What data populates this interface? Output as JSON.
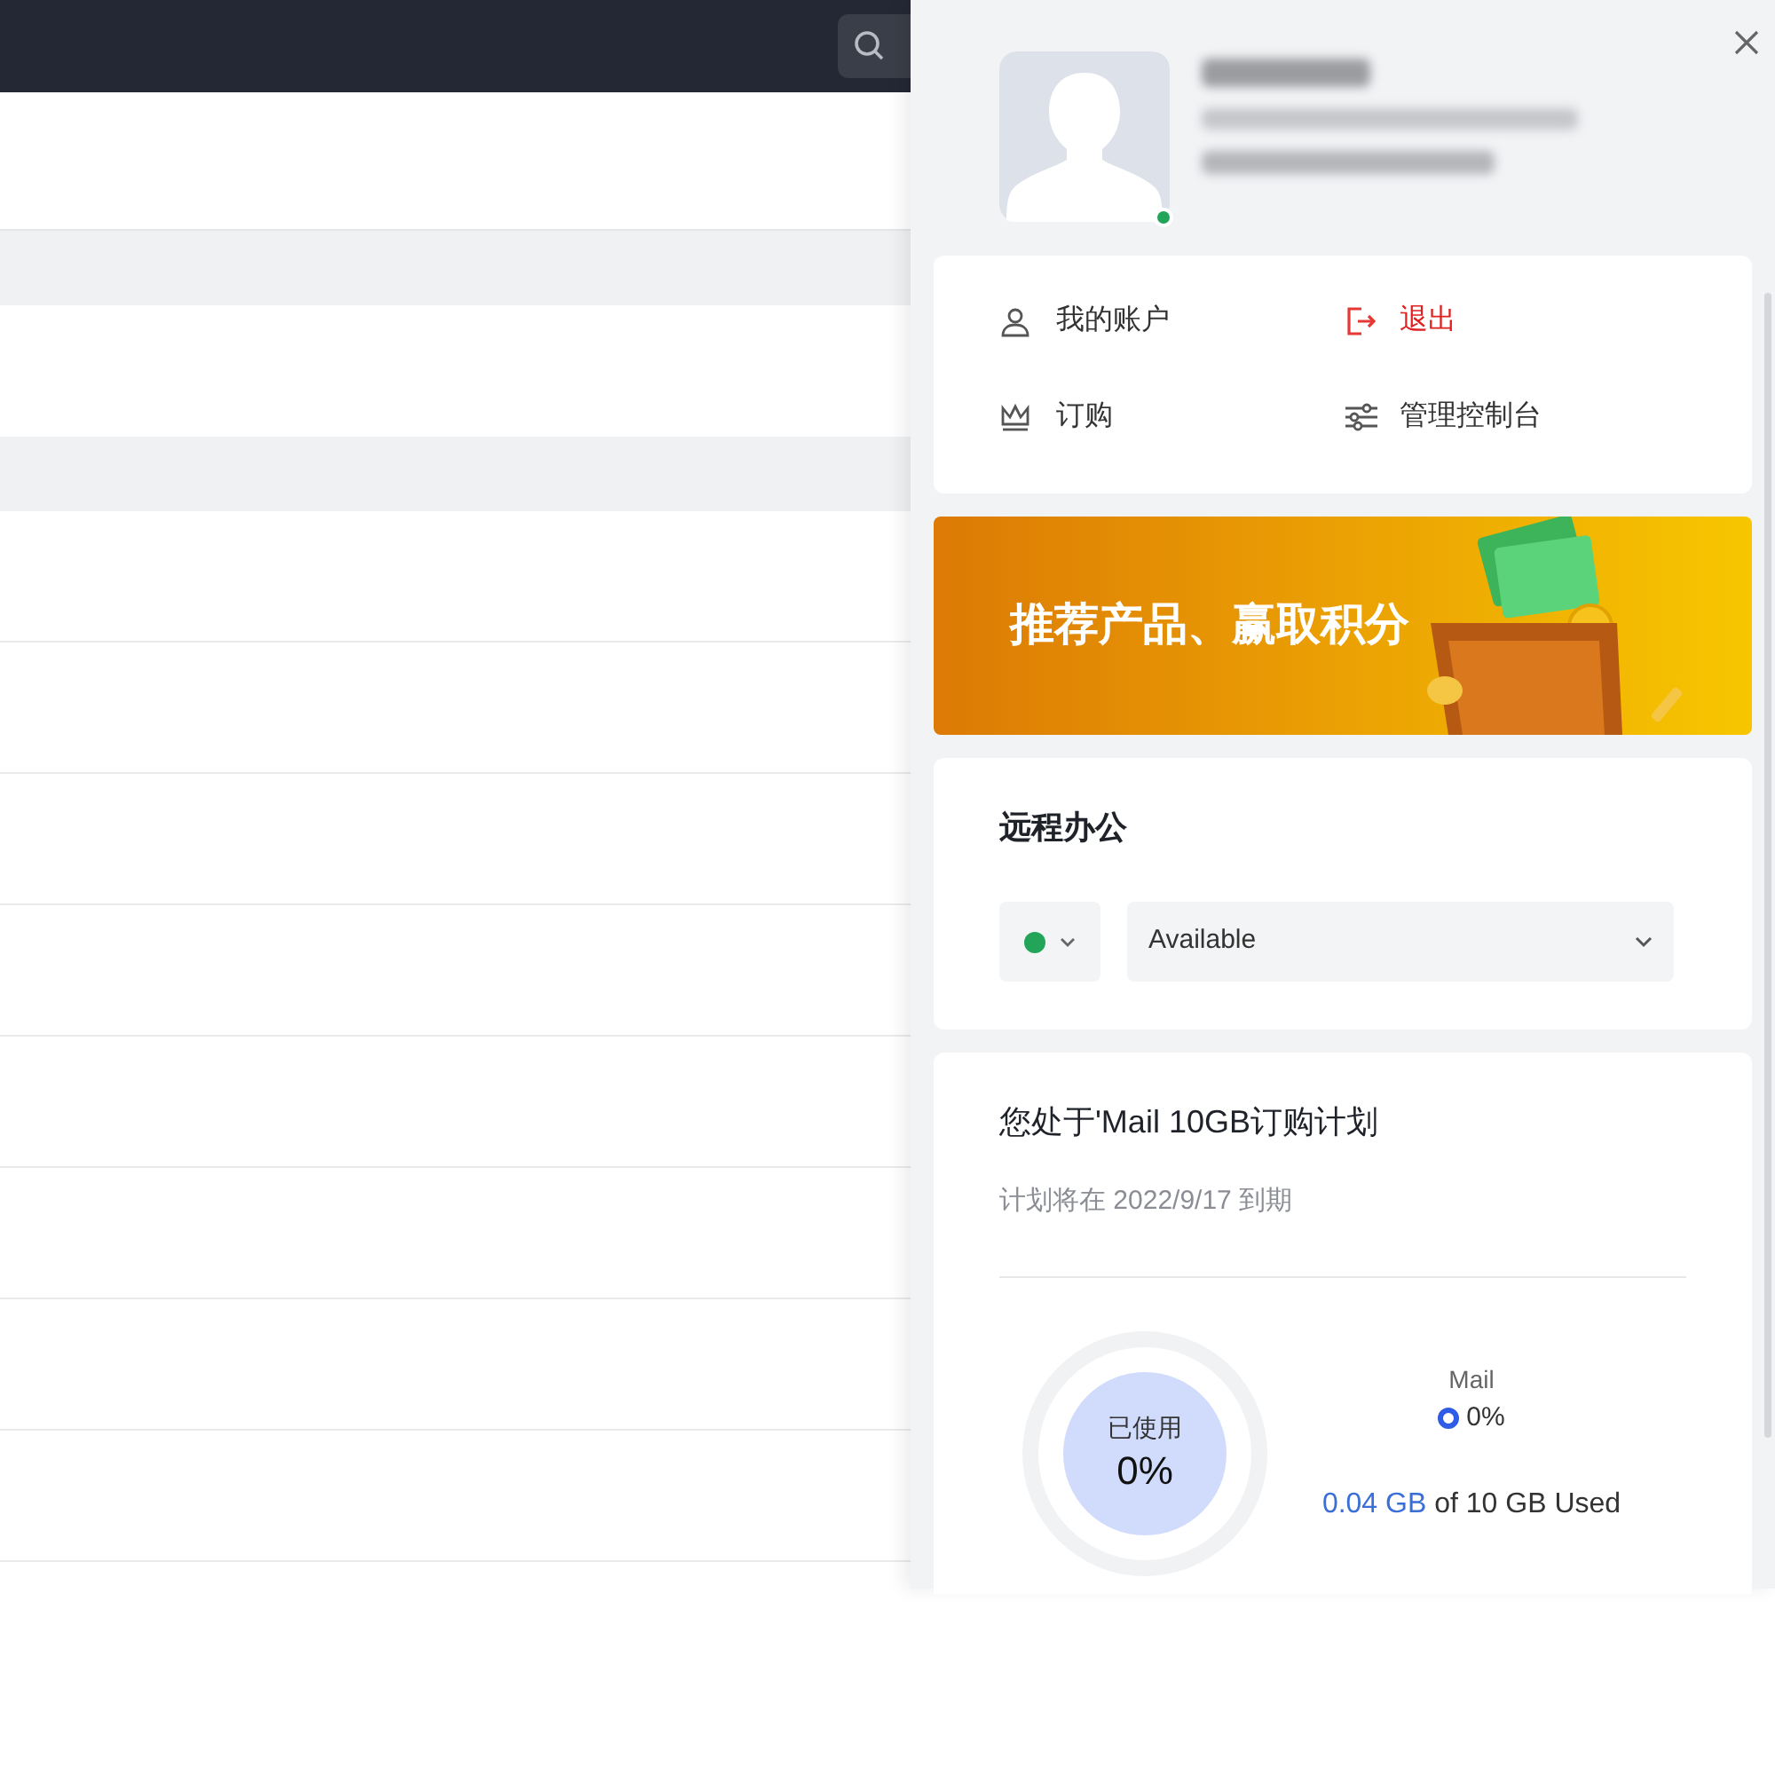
{
  "panel": {
    "presence_online": true,
    "menu": [
      {
        "kind": "account",
        "label": "我的账户"
      },
      {
        "kind": "logout",
        "label": "退出"
      },
      {
        "kind": "subscribe",
        "label": "订购"
      },
      {
        "kind": "console",
        "label": "管理控制台"
      }
    ],
    "banner": {
      "text": "推荐产品、赢取积分"
    },
    "remote": {
      "title": "远程办公",
      "status": "Available"
    },
    "plan": {
      "title": "您处于'Mail 10GB订购计划",
      "expiry": "计划将在 2022/9/17 到期",
      "used_label": "已使用",
      "used_percent": "0%",
      "legend_name": "Mail",
      "legend_value": "0%",
      "used_amount": "0.04 GB",
      "used_rest": "of 10 GB Used"
    }
  }
}
